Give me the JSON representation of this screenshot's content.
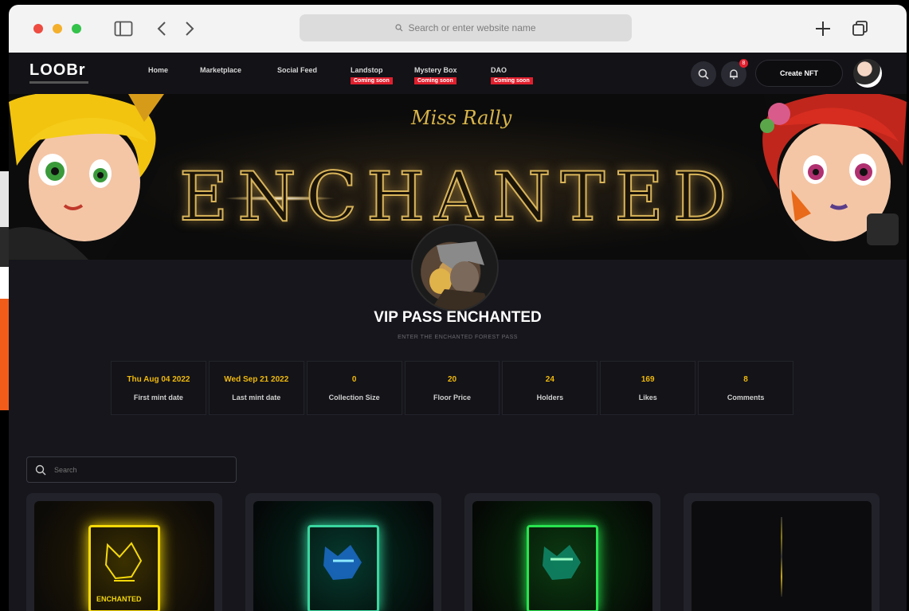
{
  "browser": {
    "url_placeholder": "Search or enter website name"
  },
  "nav": {
    "logo_text": "LOOBr",
    "items": [
      {
        "label": "Home",
        "coming_soon": ""
      },
      {
        "label": "Marketplace",
        "coming_soon": ""
      },
      {
        "label": "Social Feed",
        "coming_soon": ""
      },
      {
        "label": "Landstop",
        "coming_soon": "Coming soon"
      },
      {
        "label": "Mystery Box",
        "coming_soon": "Coming soon"
      },
      {
        "label": "DAO",
        "coming_soon": "Coming soon"
      }
    ],
    "notification_count": "8",
    "create_label": "Create NFT"
  },
  "banner": {
    "script_text": "Miss Rally",
    "title": "ENCHANTED"
  },
  "collection": {
    "title": "VIP PASS ENCHANTED",
    "subtitle": "ENTER THE ENCHANTED FOREST PASS"
  },
  "stats": [
    {
      "value": "Thu Aug 04 2022",
      "label": "First mint date"
    },
    {
      "value": "Wed Sep 21 2022",
      "label": "Last mint date"
    },
    {
      "value": "0",
      "label": "Collection Size"
    },
    {
      "value": "20",
      "label": "Floor Price"
    },
    {
      "value": "24",
      "label": "Holders"
    },
    {
      "value": "169",
      "label": "Likes"
    },
    {
      "value": "8",
      "label": "Comments"
    }
  ],
  "search": {
    "placeholder": "Search"
  },
  "cards": [
    {
      "title": "ENCHANTED",
      "glow": "#f5d90a"
    },
    {
      "title": "",
      "glow": "#3ad6a0"
    },
    {
      "title": "",
      "glow": "#29e34f"
    },
    {
      "title": "",
      "glow": "#222222"
    }
  ],
  "colors": {
    "accent": "#f0b90b",
    "badge_red": "#e0202e"
  }
}
